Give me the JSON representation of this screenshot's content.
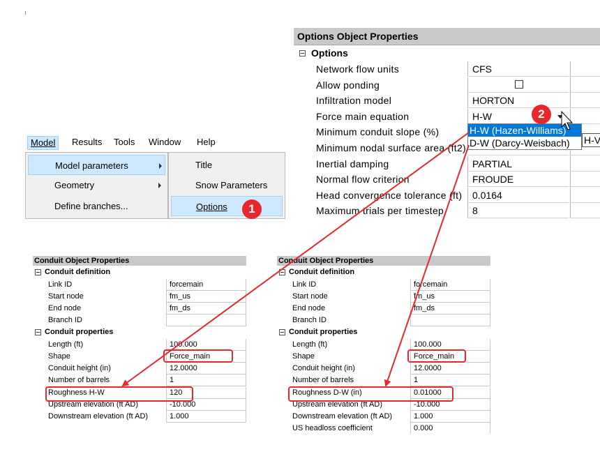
{
  "options_panel": {
    "title": "Options Object Properties",
    "group": "Options",
    "rows": [
      {
        "label": "Network flow units",
        "value": "CFS"
      },
      {
        "label": "Allow ponding",
        "value": ""
      },
      {
        "label": "Infiltration model",
        "value": "HORTON"
      },
      {
        "label": "Force main equation",
        "value": "H-W"
      },
      {
        "label": "Minimum conduit slope (%)",
        "value": ""
      },
      {
        "label": "Minimum nodal surface area (ft2)",
        "value": ""
      },
      {
        "label": "Inertial damping",
        "value": "PARTIAL"
      },
      {
        "label": "Normal flow criterion",
        "value": "FROUDE"
      },
      {
        "label": "Head convergence tolerance (ft)",
        "value": "0.0164"
      },
      {
        "label": "Maximum trials per timestep",
        "value": "8"
      }
    ],
    "dropdown_options": [
      "H-W (Hazen-Williams)",
      "D-W (Darcy-Weisbach)"
    ],
    "dropdown_tooltip": "H-V"
  },
  "menubar": {
    "items": [
      "Model",
      "Results",
      "Tools",
      "Window",
      "Help"
    ]
  },
  "model_menu": {
    "items": [
      "Model parameters",
      "Geometry",
      "Define branches..."
    ]
  },
  "parameters_submenu": {
    "items": [
      "Title",
      "Snow Parameters",
      "Options"
    ]
  },
  "badges": {
    "one": "1",
    "two": "2"
  },
  "conduit_left": {
    "title": "Conduit Object Properties",
    "group1": "Conduit definition",
    "def_rows": [
      {
        "label": "Link ID",
        "value": "forcemain"
      },
      {
        "label": "Start node",
        "value": "fm_us"
      },
      {
        "label": "End node",
        "value": "fm_ds"
      },
      {
        "label": "Branch ID",
        "value": ""
      }
    ],
    "group2": "Conduit properties",
    "prop_rows": [
      {
        "label": "Length (ft)",
        "value": "100.000"
      },
      {
        "label": "Shape",
        "value": "Force_main"
      },
      {
        "label": "Conduit height (in)",
        "value": "12.0000"
      },
      {
        "label": "Number of barrels",
        "value": "1"
      },
      {
        "label": "Roughness H-W",
        "value": "120"
      },
      {
        "label": "Upstream elevation (ft AD)",
        "value": "-10.000"
      },
      {
        "label": "Downstream elevation (ft AD)",
        "value": "1.000"
      }
    ]
  },
  "conduit_right": {
    "title": "Conduit Object Properties",
    "group1": "Conduit definition",
    "def_rows": [
      {
        "label": "Link ID",
        "value": "forcemain"
      },
      {
        "label": "Start node",
        "value": "fm_us"
      },
      {
        "label": "End node",
        "value": "fm_ds"
      },
      {
        "label": "Branch ID",
        "value": ""
      }
    ],
    "group2": "Conduit properties",
    "prop_rows": [
      {
        "label": "Length (ft)",
        "value": "100.000"
      },
      {
        "label": "Shape",
        "value": "Force_main"
      },
      {
        "label": "Conduit height (in)",
        "value": "12.0000"
      },
      {
        "label": "Number of barrels",
        "value": "1"
      },
      {
        "label": "Roughness D-W (in)",
        "value": "0.01000"
      },
      {
        "label": "Upstream elevation (ft AD)",
        "value": "-10.000"
      },
      {
        "label": "Downstream elevation (ft AD)",
        "value": "1.000"
      },
      {
        "label": "US headloss coefficient",
        "value": "0.000"
      }
    ]
  },
  "colors": {
    "annotation_red": "#e8262c",
    "selection_blue": "#0078d7",
    "header_gray": "#c9c9c9"
  }
}
